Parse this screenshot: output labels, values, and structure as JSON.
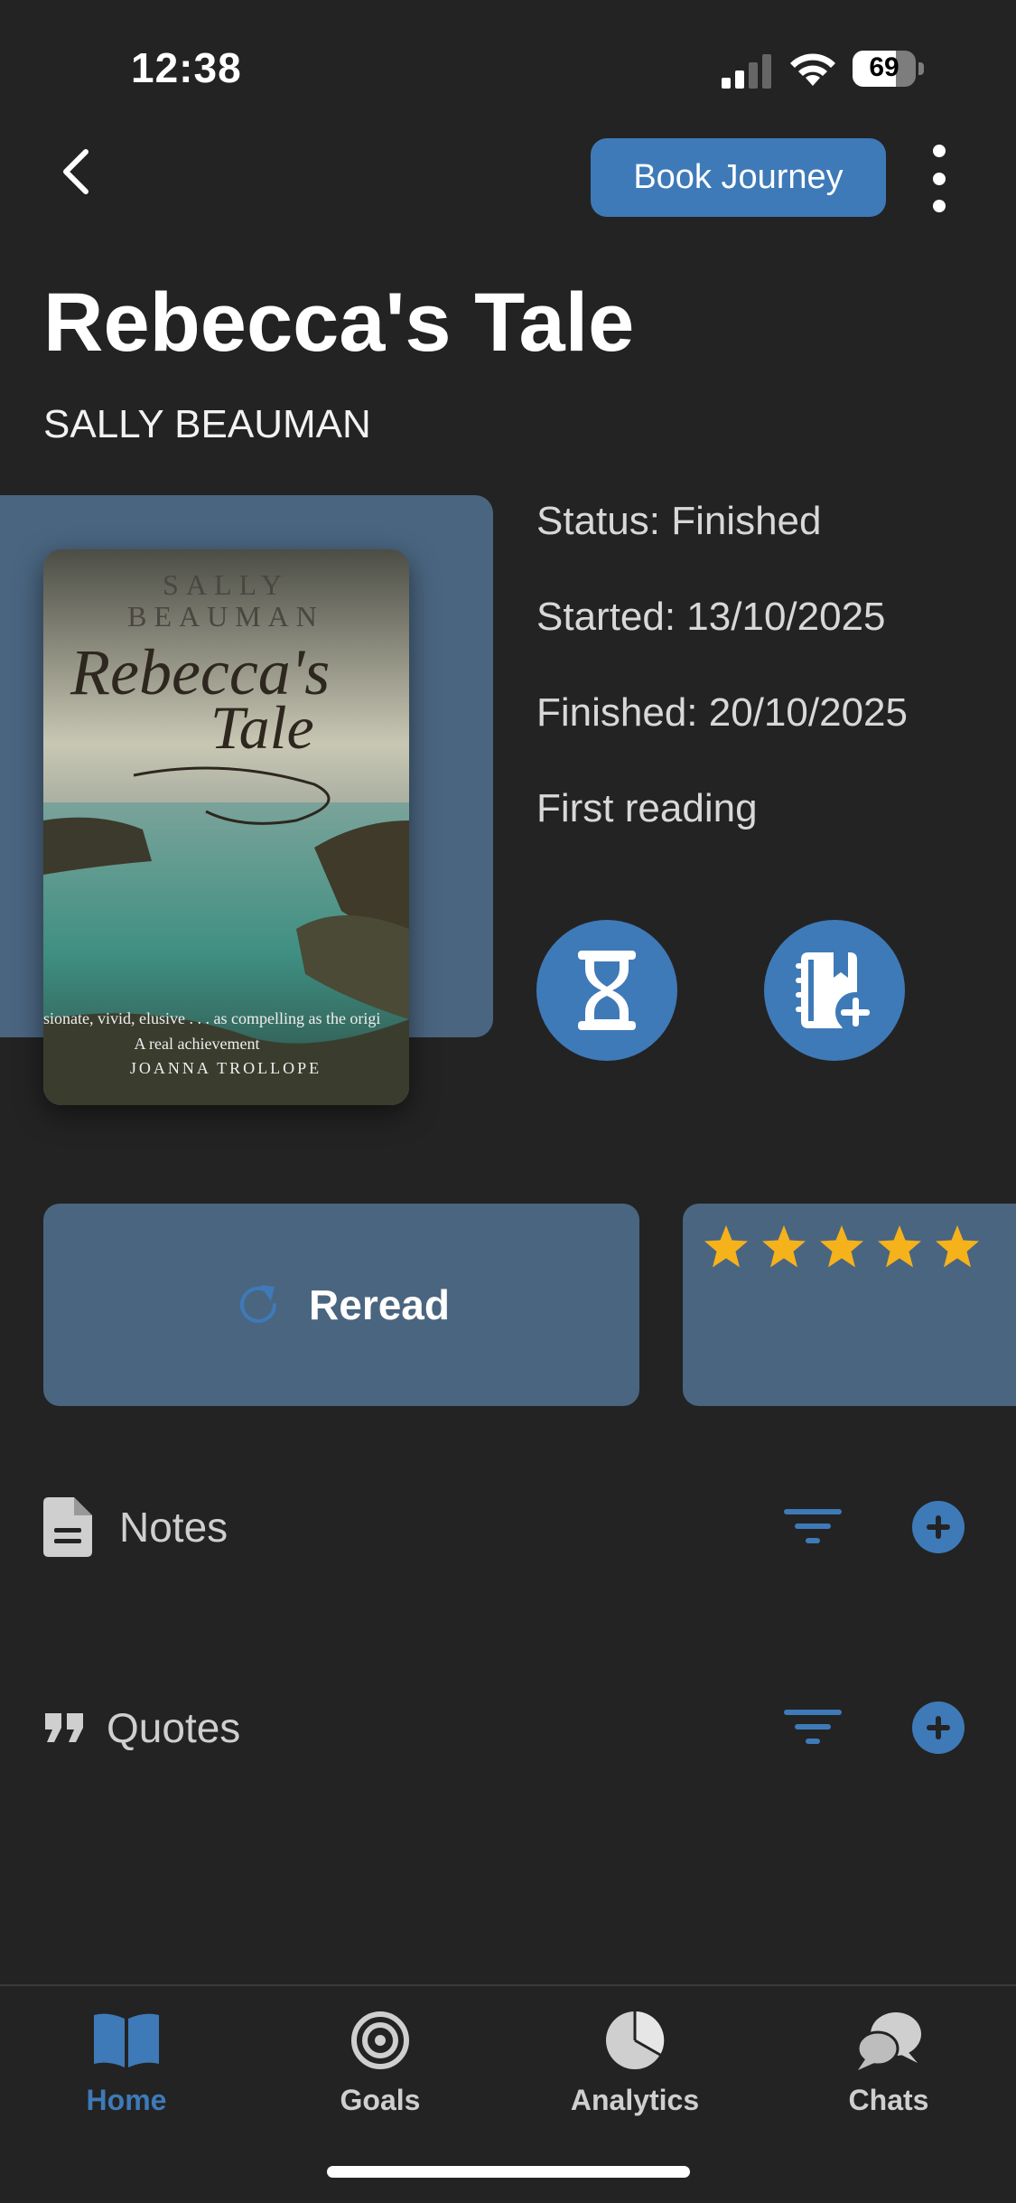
{
  "status_bar": {
    "time": "12:38",
    "battery": "69",
    "battery_level": 0.69
  },
  "header": {
    "journey_button": "Book Journey"
  },
  "book": {
    "title": "Rebecca's Tale",
    "author": "SALLY BEAUMAN",
    "status": "Status: Finished",
    "started": "Started: 13/10/2025",
    "finished": "Finished: 20/10/2025",
    "reading": "First reading",
    "cover": {
      "author_line1": "SALLY",
      "author_line2": "BEAUMAN",
      "title_line1": "Rebecca's",
      "title_line2": "Tale",
      "blurb": "sionate, vivid, elusive . . . as compelling as the origi",
      "blurb2": "A real achievement",
      "endorser": "JOANNA TROLLOPE"
    }
  },
  "actions": {
    "reread_label": "Reread"
  },
  "rating": {
    "value": 5,
    "max": 5,
    "color": "#f5b21b"
  },
  "sections": {
    "notes_label": "Notes",
    "quotes_label": "Quotes"
  },
  "tabs": [
    {
      "label": "Home",
      "icon": "book-open-icon",
      "active": true
    },
    {
      "label": "Goals",
      "icon": "target-icon",
      "active": false
    },
    {
      "label": "Analytics",
      "icon": "pie-chart-icon",
      "active": false
    },
    {
      "label": "Chats",
      "icon": "chat-bubbles-icon",
      "active": false
    }
  ],
  "colors": {
    "accent": "#3e7ab8",
    "card": "#4a6580",
    "background": "#232323"
  }
}
